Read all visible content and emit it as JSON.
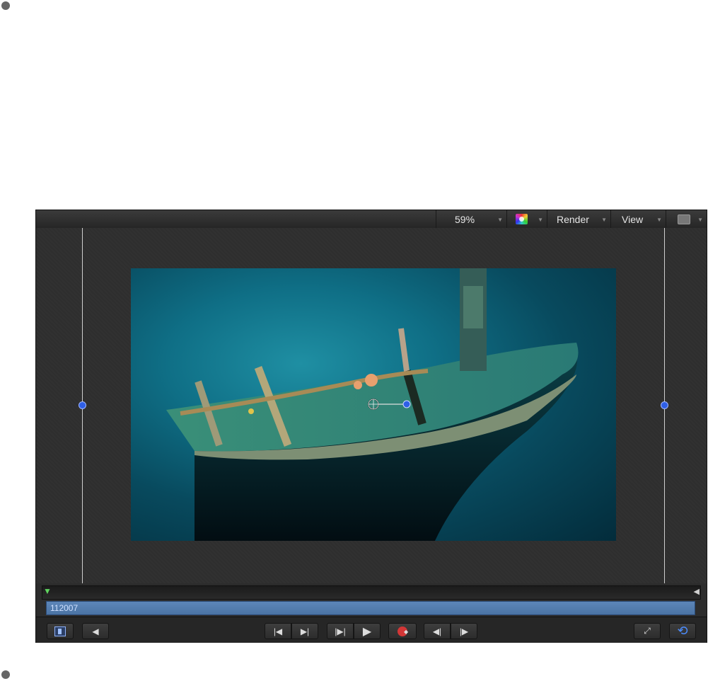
{
  "toolbar": {
    "zoom_label": "59%",
    "render_label": "Render",
    "view_label": "View",
    "dropdown_icon": "triangle-down-icon",
    "color_icon": "color-channels-icon",
    "layout_icon": "layout-icon"
  },
  "canvas": {
    "frame_description_icon": "shipwreck-image",
    "guide_color": "#cfcfcf",
    "handle_color": "#2f5fe6"
  },
  "timeline": {
    "clip_label": "112007"
  },
  "transport": {
    "inspector_icon": "inspector-toggle-icon",
    "audio_icon": "speaker-icon",
    "go_start_icon": "go-to-start-icon",
    "go_end_icon": "go-to-end-icon",
    "frame_step_icon": "step-frame-icon",
    "play_icon": "play-icon",
    "record_icon": "record-icon",
    "prev_keyframe_icon": "previous-keyframe-icon",
    "next_keyframe_icon": "next-keyframe-icon",
    "fullscreen_icon": "fullscreen-icon",
    "loop_icon": "loop-icon"
  },
  "colors": {
    "accent": "#2f5fe6",
    "record": "#d33636",
    "playhead": "#5fd35f",
    "clip": "#5c86b9"
  }
}
